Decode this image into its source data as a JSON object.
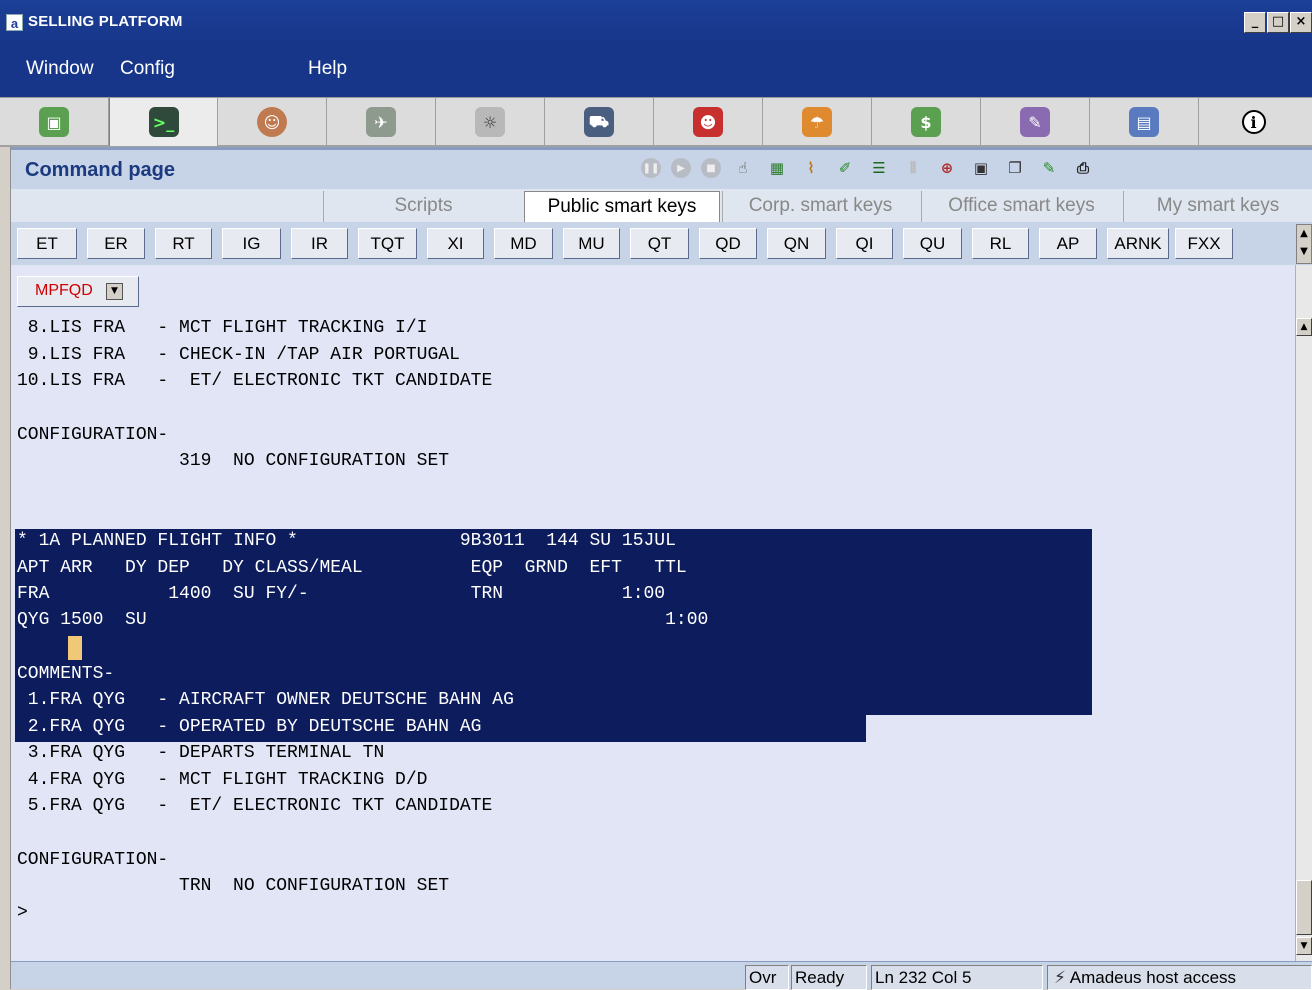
{
  "window": {
    "title": "SELLING PLATFORM",
    "logo": "a",
    "controls": [
      "_",
      "□",
      "×"
    ]
  },
  "menu": [
    "Window",
    "Config",
    "Help"
  ],
  "toolbar": {
    "icons": [
      "suitcase-icon",
      "command-terminal-icon",
      "agent-person-icon",
      "hotel-airplane-icon",
      "rail-icon",
      "car-icon",
      "concierge-person-icon",
      "umbrella-icon",
      "money-icon",
      "queue-icon",
      "document-icon",
      "info-icon"
    ]
  },
  "command_page": {
    "title": "Command page",
    "header_icons": [
      "pause-icon",
      "play-icon",
      "stop-icon",
      "hand-icon",
      "script-icon",
      "broom-icon",
      "brush-icon",
      "list-icon",
      "disabled-icon",
      "magnify-icon",
      "save-icon",
      "copy-icon",
      "pencil-icon",
      "print-icon"
    ]
  },
  "tabs": [
    "Scripts",
    "Public smart keys",
    "Corp. smart keys",
    "Office smart keys",
    "My smart keys"
  ],
  "active_tab": "Public smart keys",
  "smart_keys": [
    "ET",
    "ER",
    "RT",
    "IG",
    "IR",
    "TQT",
    "XI",
    "MD",
    "MU",
    "QT",
    "QD",
    "QN",
    "QI",
    "QU",
    "RL",
    "AP",
    "ARNK",
    "FXX"
  ],
  "dropdown": {
    "value": "MPFQD"
  },
  "terminal": {
    "lines": [
      " 8.LIS FRA   - MCT FLIGHT TRACKING I/I",
      " 9.LIS FRA   - CHECK-IN /TAP AIR PORTUGAL",
      "10.LIS FRA   -  ET/ ELECTRONIC TKT CANDIDATE",
      "",
      "CONFIGURATION-",
      "               319  NO CONFIGURATION SET",
      "",
      "",
      "* 1A PLANNED FLIGHT INFO *               9B3011  144 SU 15JUL",
      "APT ARR   DY DEP   DY CLASS/MEAL          EQP  GRND  EFT   TTL",
      "FRA           1400  SU FY/-               TRN           1:00",
      "QYG 1500  SU                                                1:00",
      "",
      "COMMENTS-",
      " 1.FRA QYG   - AIRCRAFT OWNER DEUTSCHE BAHN AG",
      " 2.FRA QYG   - OPERATED BY DEUTSCHE BAHN AG",
      " 3.FRA QYG   - DEPARTS TERMINAL TN",
      " 4.FRA QYG   - MCT FLIGHT TRACKING D/D",
      " 5.FRA QYG   -  ET/ ELECTRONIC TKT CANDIDATE",
      "",
      "CONFIGURATION-",
      "               TRN  NO CONFIGURATION SET",
      ">"
    ]
  },
  "status": {
    "mode": "Ovr",
    "state": "Ready",
    "position": "Ln 232 Col 5",
    "host": "Amadeus host access"
  }
}
